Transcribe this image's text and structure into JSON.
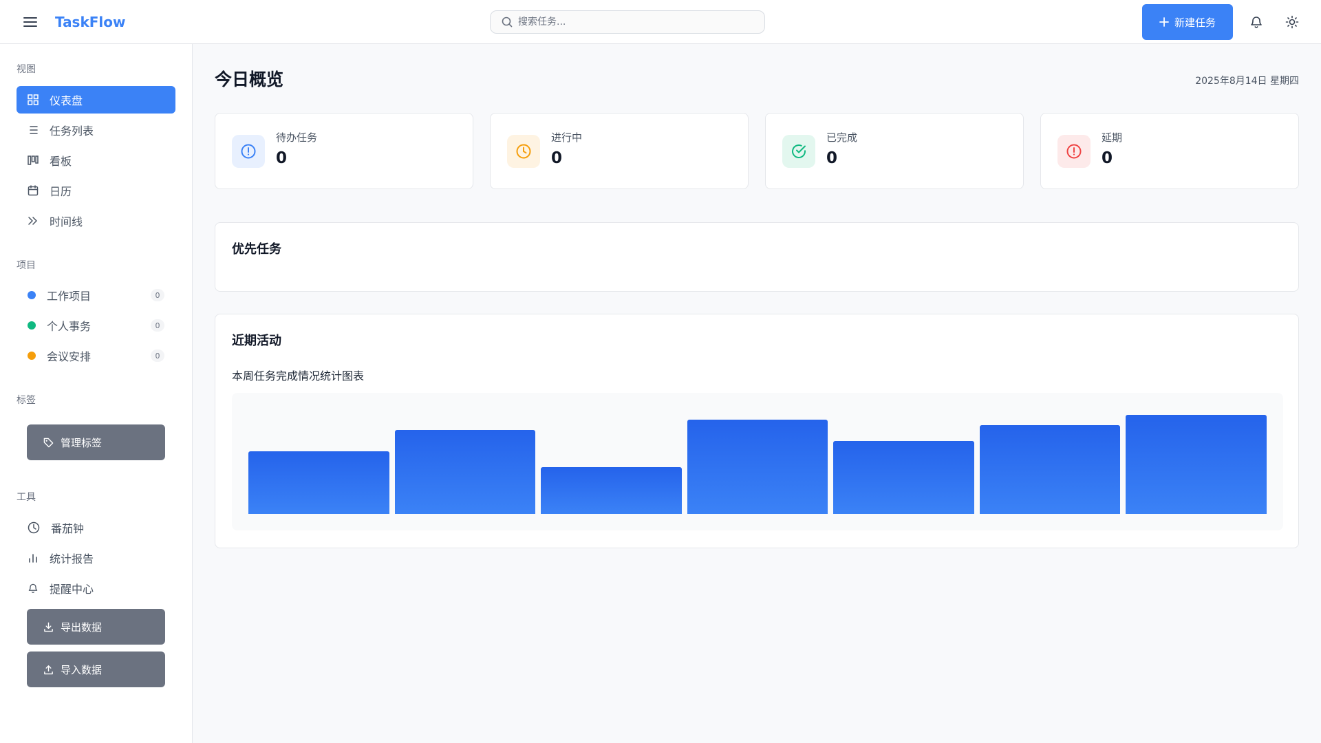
{
  "header": {
    "brand": "TaskFlow",
    "search_placeholder": "搜索任务...",
    "new_task_label": "新建任务"
  },
  "sidebar": {
    "views_title": "视图",
    "views": [
      {
        "label": "仪表盘",
        "icon": "grid-icon",
        "active": true
      },
      {
        "label": "任务列表",
        "icon": "list-icon"
      },
      {
        "label": "看板",
        "icon": "kanban-icon"
      },
      {
        "label": "日历",
        "icon": "calendar-icon"
      },
      {
        "label": "时间线",
        "icon": "timeline-icon"
      }
    ],
    "projects_title": "项目",
    "projects": [
      {
        "label": "工作项目",
        "count": "0",
        "color": "#3b82f6"
      },
      {
        "label": "个人事务",
        "count": "0",
        "color": "#10b981"
      },
      {
        "label": "会议安排",
        "count": "0",
        "color": "#f59e0b"
      }
    ],
    "tags_title": "标签",
    "manage_tags_label": "管理标签",
    "tools_title": "工具",
    "tools": [
      {
        "label": "番茄钟",
        "icon": "clock-icon"
      },
      {
        "label": "统计报告",
        "icon": "bar-chart-icon"
      },
      {
        "label": "提醒中心",
        "icon": "bell-icon"
      }
    ],
    "export_label": "导出数据",
    "import_label": "导入数据"
  },
  "main": {
    "title": "今日概览",
    "date": "2025年8月14日 星期四",
    "stats": [
      {
        "label": "待办任务",
        "value": "0",
        "color": "#3b82f6",
        "bg": "#e8f0fe",
        "icon": "alert-circle-icon"
      },
      {
        "label": "进行中",
        "value": "0",
        "color": "#f59e0b",
        "bg": "#fef3e2",
        "icon": "clock-icon"
      },
      {
        "label": "已完成",
        "value": "0",
        "color": "#10b981",
        "bg": "#e3f7ef",
        "icon": "check-circle-icon"
      },
      {
        "label": "延期",
        "value": "0",
        "color": "#ef4444",
        "bg": "#fdeaea",
        "icon": "alert-icon"
      }
    ],
    "priority_title": "优先任务",
    "activity_title": "近期活动",
    "chart_caption": "本周任务完成情况统计图表"
  },
  "chart_data": {
    "type": "bar",
    "categories": [],
    "values": [
      60,
      80,
      45,
      90,
      70,
      85,
      95
    ],
    "ylim": [
      0,
      100
    ],
    "title": "",
    "xlabel": "",
    "ylabel": ""
  }
}
